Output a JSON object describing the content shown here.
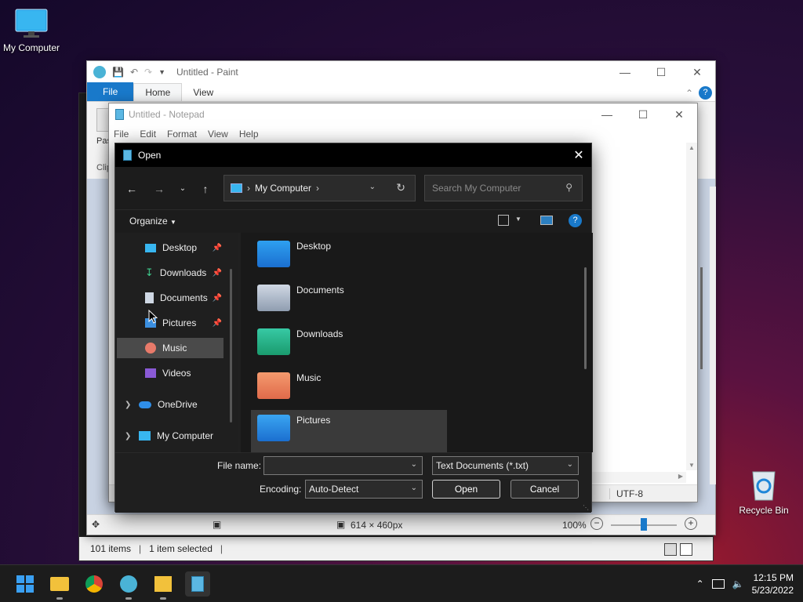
{
  "desktop": {
    "my_computer_label": "My Computer",
    "recycle_bin_label": "Recycle Bin"
  },
  "explorer": {
    "status_items": "101 items",
    "status_selected": "1 item selected"
  },
  "paint": {
    "title": "Untitled - Paint",
    "tabs": {
      "file": "File",
      "home": "Home",
      "view": "View"
    },
    "left_labels": {
      "paste": "Pas",
      "clip": "Clip"
    },
    "status_size": "614 × 460px",
    "zoom": "100%"
  },
  "notepad": {
    "title": "Untitled - Notepad",
    "menu": {
      "file": "File",
      "edit": "Edit",
      "format": "Format",
      "view": "View",
      "help": "Help"
    },
    "encoding_status": "UTF-8"
  },
  "dialog": {
    "title": "Open",
    "address_location": "My Computer",
    "search_placeholder": "Search My Computer",
    "organize_label": "Organize",
    "sidebar": [
      {
        "label": "Desktop",
        "pinned": true
      },
      {
        "label": "Downloads",
        "pinned": true
      },
      {
        "label": "Documents",
        "pinned": true
      },
      {
        "label": "Pictures",
        "pinned": true
      },
      {
        "label": "Music",
        "pinned": false,
        "selected": true
      },
      {
        "label": "Videos",
        "pinned": false
      }
    ],
    "tree": [
      {
        "label": "OneDrive"
      },
      {
        "label": "My Computer"
      }
    ],
    "folders": [
      {
        "label": "Desktop"
      },
      {
        "label": "Documents"
      },
      {
        "label": "Downloads"
      },
      {
        "label": "Music"
      },
      {
        "label": "Pictures"
      }
    ],
    "file_name_label": "File name:",
    "file_name_value": "",
    "file_type_value": "Text Documents (*.txt)",
    "encoding_label": "Encoding:",
    "encoding_value": "Auto-Detect",
    "open_button": "Open",
    "cancel_button": "Cancel"
  },
  "taskbar": {
    "time": "12:15 PM",
    "date": "5/23/2022"
  }
}
